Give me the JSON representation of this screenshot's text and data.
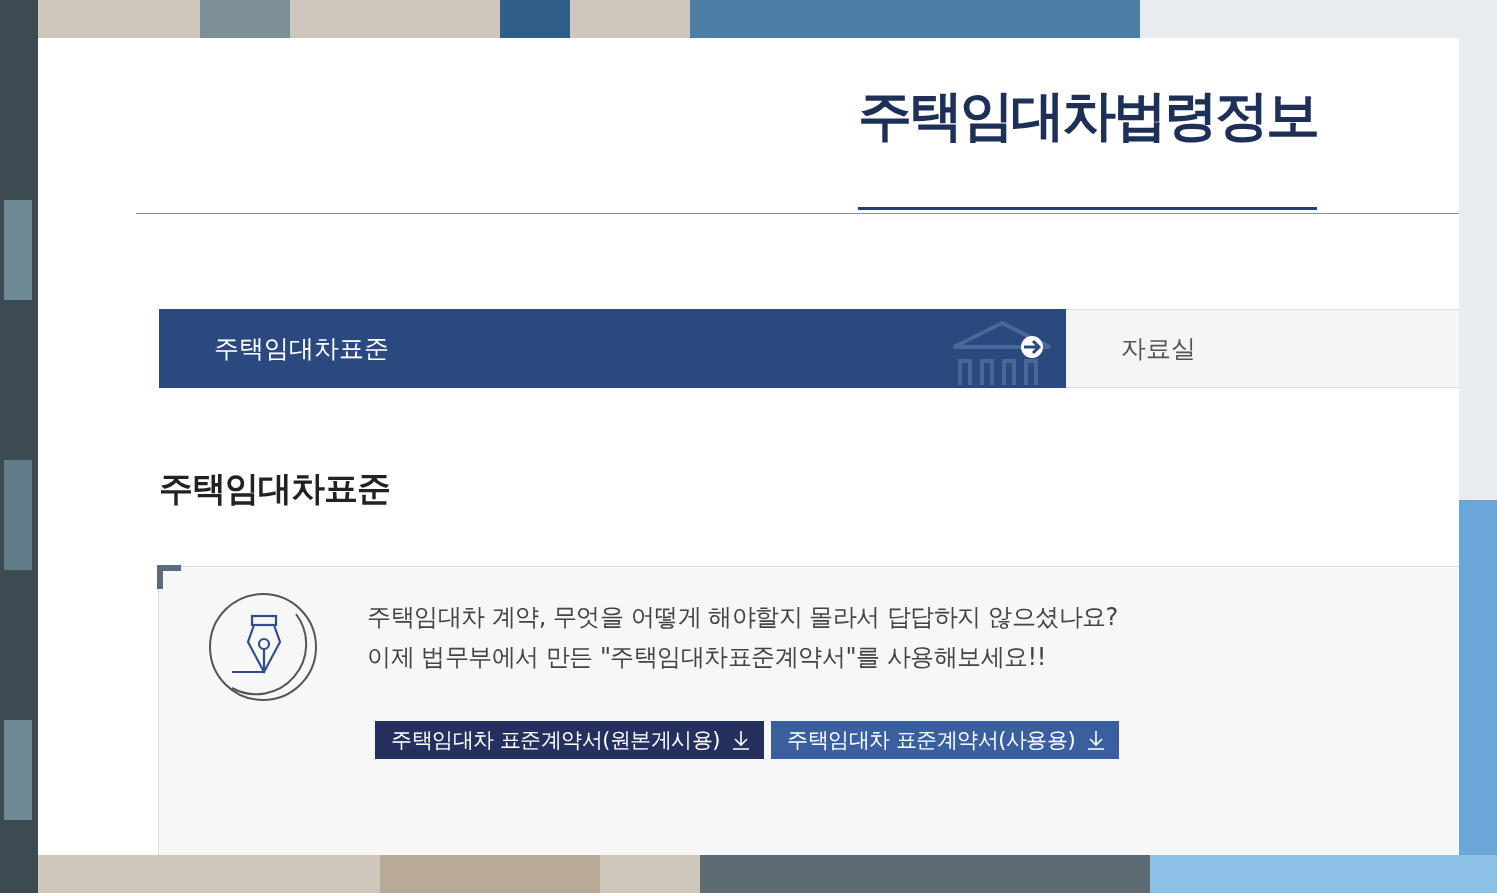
{
  "page_title": "주택임대차법령정보",
  "tabs": [
    {
      "label": "주택임대차표준",
      "selected": true
    },
    {
      "label": "자료실",
      "selected": false
    }
  ],
  "section_title": "주택임대차표준",
  "intro": {
    "lines": [
      "주택임대차 계약, 무엇을 어떻게 해야할지 몰라서 답답하지 않으셨나요?",
      "이제 법무부에서 만든 \"주택임대차표준계약서\"를 사용해보세요!!"
    ]
  },
  "buttons": [
    {
      "label": "주택임대차 표준계약서(원본게시용)",
      "kind": "primary"
    },
    {
      "label": "주택임대차 표준계약서(사용용)",
      "kind": "secondary"
    }
  ]
}
